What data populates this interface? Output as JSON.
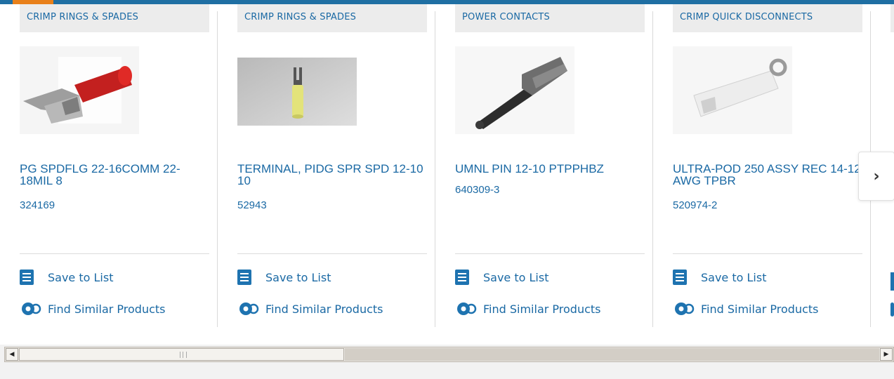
{
  "colors": {
    "accent_orange": "#e8801a",
    "brand_blue": "#1a69a4",
    "pill_bg": "#ececec"
  },
  "products": [
    {
      "category": "CRIMP RINGS & SPADES",
      "title": "PG SPDFLG 22-16COMM 22-18MIL 8",
      "part": "324169",
      "image_icon": "red-spade-terminal-image"
    },
    {
      "category": "CRIMP RINGS & SPADES",
      "title": "TERMINAL, PIDG SPR SPD 12-10 10",
      "part": "52943",
      "image_icon": "yellow-spade-terminal-image"
    },
    {
      "category": "POWER CONTACTS",
      "title": "UMNL PIN 12-10 PTPPHBZ",
      "part": "640309-3",
      "image_icon": "power-contact-pin-image"
    },
    {
      "category": "CRIMP QUICK DISCONNECTS",
      "title": "ULTRA-POD 250 ASSY REC 14-12 AWG TPBR",
      "part": "520974-2",
      "image_icon": "quick-disconnect-image"
    }
  ],
  "actions": {
    "save_label": "Save to List",
    "similar_label": "Find Similar Products"
  },
  "carousel": {
    "next_icon": "chevron-right-icon"
  },
  "scrollbar": {
    "left_arrow": "◀",
    "right_arrow": "▶"
  }
}
